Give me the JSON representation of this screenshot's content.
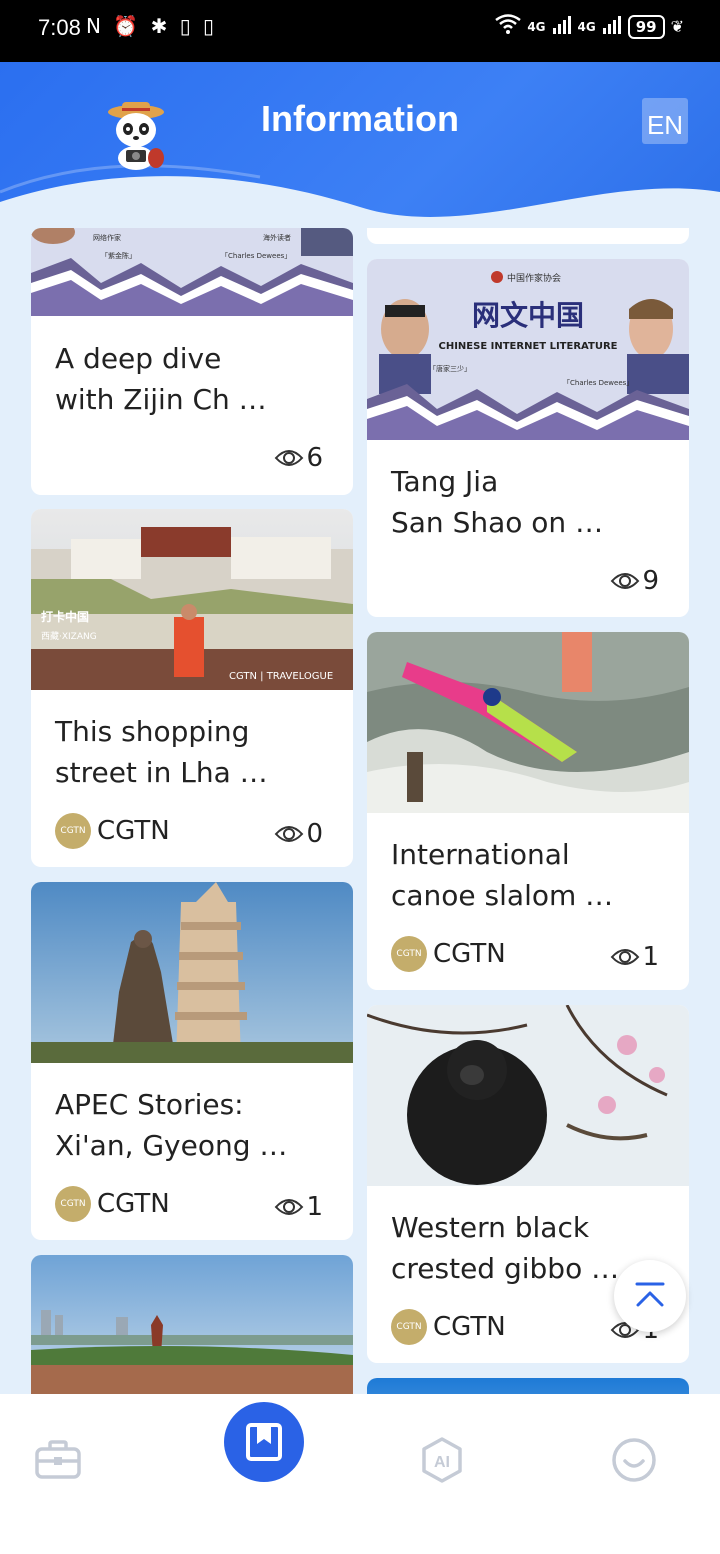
{
  "status": {
    "time": "7:08",
    "left_icons": "N ⏰ ✱ ▯ ▯",
    "net1": "4G",
    "net2": "4G",
    "battery": "99"
  },
  "header": {
    "title": "Information",
    "lang": "EN"
  },
  "cards_left": [
    {
      "title_line1": "A deep dive",
      "title_line2": "with Zijin Ch …",
      "author": "",
      "views": "6"
    },
    {
      "title_line1": "This shopping",
      "title_line2": "street in Lha …",
      "author": "CGTN",
      "views": "0"
    },
    {
      "title_line1": "APEC Stories:",
      "title_line2": "Xi'an, Gyeong …",
      "author": "CGTN",
      "views": "1"
    }
  ],
  "cards_right": [
    {
      "title_line1": "Tang Jia",
      "title_line2": "San Shao on  …",
      "author": "",
      "views": "9"
    },
    {
      "title_line1": "International",
      "title_line2": "canoe slalom  …",
      "author": "CGTN",
      "views": "1"
    },
    {
      "title_line1": "Western black",
      "title_line2": "crested gibbo …",
      "author": "CGTN",
      "views": "1"
    }
  ],
  "thumb_texts": {
    "literature_cn": "网文中国",
    "literature_en": "CHINESE INTERNET LITERATURE",
    "guest_left": "「唐家三少」",
    "guest_right": "「Charles Dewees」",
    "guest_left2": "「紫金陈」",
    "travelogue": "CGTN | TRAVELOGUE",
    "daka": "打卡中国",
    "xizang": "西藏·XIZANG"
  },
  "avatar_label": "CGTN",
  "nav": {
    "icons": [
      "briefcase-icon",
      "bookmark-icon",
      "ai-icon",
      "smile-icon"
    ],
    "ai_text": "AI"
  },
  "colors": {
    "accent": "#2a62e6",
    "header_blue": "#3277f0",
    "page_bg": "#e3effb",
    "avatar_gold": "#c4ad6b"
  }
}
